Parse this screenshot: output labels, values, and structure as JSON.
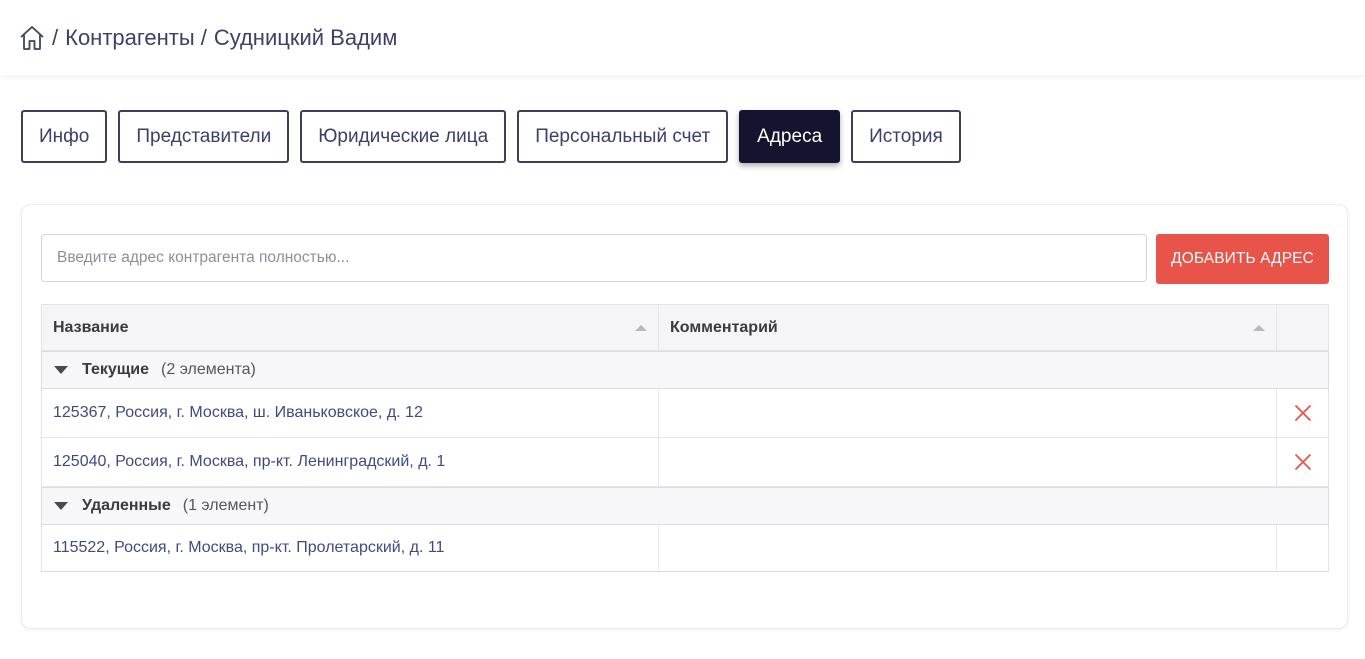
{
  "breadcrumb": {
    "sep1": "/",
    "section": "Контрагенты",
    "sep2": "/",
    "current": "Судницкий Вадим"
  },
  "tabs": [
    {
      "label": "Инфо",
      "active": false
    },
    {
      "label": "Представители",
      "active": false
    },
    {
      "label": "Юридические лица",
      "active": false
    },
    {
      "label": "Персональный счет",
      "active": false
    },
    {
      "label": "Адреса",
      "active": true
    },
    {
      "label": "История",
      "active": false
    }
  ],
  "address_form": {
    "placeholder": "Введите адрес контрагента полностью...",
    "value": "",
    "add_button_label": "ДОБАВИТЬ АДРЕС"
  },
  "table": {
    "columns": {
      "name": "Название",
      "comment": "Комментарий"
    },
    "groups": [
      {
        "title": "Текущие",
        "count": "(2 элемента)",
        "rows": [
          {
            "name": "125367, Россия, г. Москва, ш. Иваньковское, д. 12",
            "comment": ""
          },
          {
            "name": "125040, Россия, г. Москва, пр-кт. Ленинградский, д. 1",
            "comment": ""
          }
        ]
      },
      {
        "title": "Удаленные",
        "count": "(1 элемент)",
        "rows": [
          {
            "name": "115522, Россия, г. Москва, пр-кт. Пролетарский, д. 11",
            "comment": ""
          }
        ]
      }
    ]
  },
  "colors": {
    "accent_dark": "#14142e",
    "danger": "#e8534a",
    "link": "#3f4a82"
  },
  "icons": {
    "home": "home-icon",
    "sort": "sort-asc-icon",
    "group_toggle": "caret-down-icon",
    "delete": "close-icon"
  }
}
